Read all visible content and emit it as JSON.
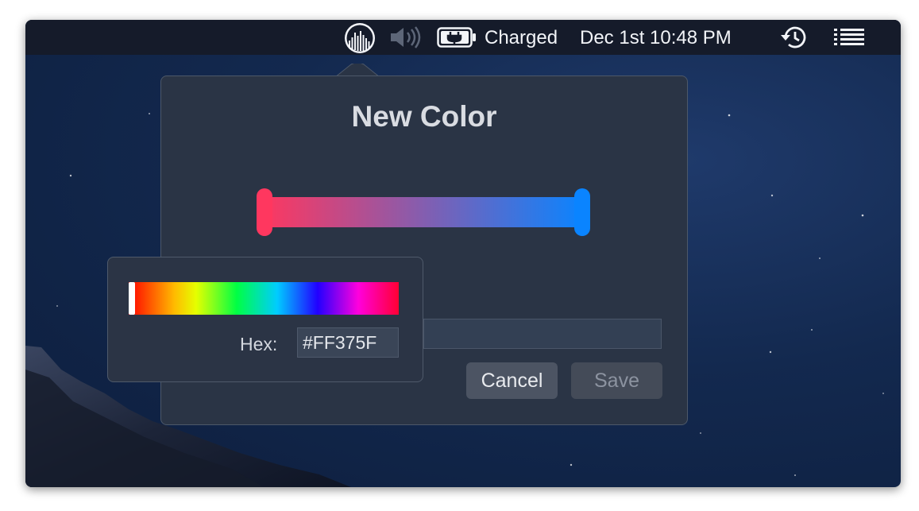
{
  "menubar": {
    "battery_status": "Charged",
    "datetime": "Dec 1st 10:48 PM",
    "icons": [
      "app-waveform-icon",
      "speaker-volume-icon",
      "battery-charging-icon",
      "time-machine-icon",
      "list-menu-icon"
    ]
  },
  "dialog": {
    "title": "New Color",
    "gradient": {
      "start_color": "#FF375F",
      "end_color": "#0A84FF"
    },
    "text_field_value": "",
    "cancel_label": "Cancel",
    "save_label": "Save"
  },
  "picker": {
    "hex_label": "Hex:",
    "hex_value": "#FF375F",
    "spectrum_position": 0.0
  }
}
